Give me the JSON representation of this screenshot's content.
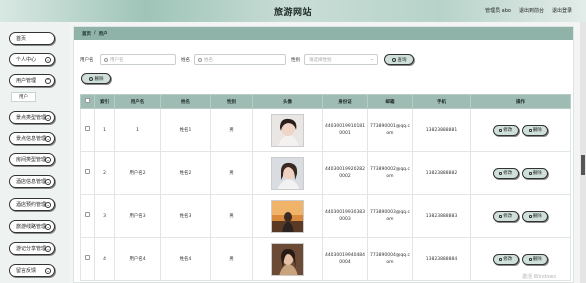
{
  "header": {
    "site_title": "旅游网站",
    "admin_label": "管理员 abo",
    "back_home": "退出到前台",
    "logout": "退出登录"
  },
  "sidebar": {
    "items": [
      {
        "label": "首页"
      },
      {
        "label": "个人中心"
      },
      {
        "label": "用户管理"
      },
      {
        "label": "景点类型管理"
      },
      {
        "label": "景点信息管理"
      },
      {
        "label": "房间类型管理"
      },
      {
        "label": "酒店信息管理"
      },
      {
        "label": "酒店预约管理"
      },
      {
        "label": "旅游线路管理"
      },
      {
        "label": "游记分享管理"
      },
      {
        "label": "留言反馈"
      }
    ],
    "sub_item": "用户"
  },
  "breadcrumb": {
    "home": "首页",
    "sep": "/",
    "current": "用户"
  },
  "search": {
    "username_label": "用户名",
    "username_placeholder": "用户名",
    "name_label": "姓名",
    "name_placeholder": "姓名",
    "gender_label": "性别",
    "gender_placeholder": "请选择性别",
    "query_button": "查询",
    "delete_button": "删除"
  },
  "table": {
    "headers": [
      "索引",
      "用户名",
      "姓名",
      "性别",
      "头像",
      "身份证",
      "邮箱",
      "手机",
      "操作"
    ],
    "edit_label": "修改",
    "delete_label": "删除",
    "rows": [
      {
        "index": "1",
        "username": "1",
        "name": "姓名1",
        "gender": "男",
        "id_card_1": "44030019910181",
        "id_card_2": "0001",
        "email_1": "773890001@qq.c",
        "email_2": "om",
        "phone": "13823888881"
      },
      {
        "index": "2",
        "username": "用户名2",
        "name": "姓名2",
        "gender": "男",
        "id_card_1": "44030019920282",
        "id_card_2": "0002",
        "email_1": "773890002@qq.c",
        "email_2": "om",
        "phone": "13823888882"
      },
      {
        "index": "3",
        "username": "用户名3",
        "name": "姓名3",
        "gender": "男",
        "id_card_1": "44030019930383",
        "id_card_2": "0003",
        "email_1": "773890003@qq.c",
        "email_2": "om",
        "phone": "13823888883"
      },
      {
        "index": "4",
        "username": "用户名4",
        "name": "姓名4",
        "gender": "男",
        "id_card_1": "44030019940484",
        "id_card_2": "0004",
        "email_1": "773890004@qq.c",
        "email_2": "om",
        "phone": "13823888884"
      }
    ]
  },
  "watermark": "激活 Windows"
}
